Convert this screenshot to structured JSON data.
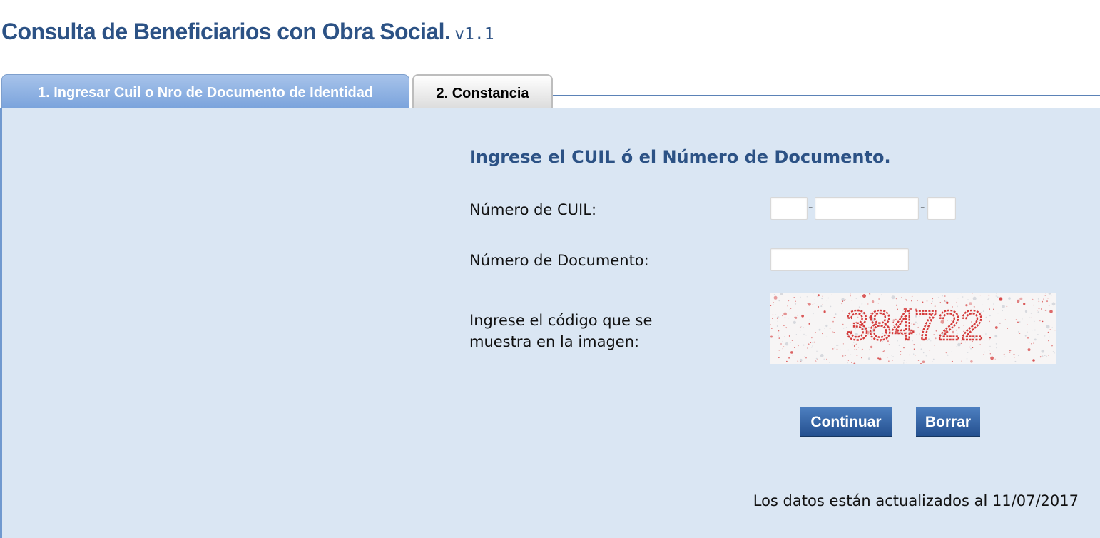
{
  "header": {
    "title": "Consulta de Beneficiarios con Obra Social.",
    "version": "v1.1"
  },
  "tabs": [
    {
      "label": "1. Ingresar Cuil o Nro de Documento de Identidad",
      "state": "inactive"
    },
    {
      "label": "2. Constancia",
      "state": "active"
    }
  ],
  "form": {
    "title": "Ingrese el CUIL ó el Número de Documento.",
    "cuil_label": "Número de CUIL:",
    "cuil_separator": "-",
    "cuil_prefix_value": "",
    "cuil_number_value": "",
    "cuil_check_value": "",
    "documento_label": "Número de Documento:",
    "documento_value": "",
    "captcha_label_line1": "Ingrese el código que se",
    "captcha_label_line2": "muestra en la imagen:",
    "captcha_code": "384722",
    "continuar_label": "Continuar",
    "borrar_label": "Borrar"
  },
  "footer": {
    "updated_note": "Los datos están actualizados al 11/07/2017"
  },
  "colors": {
    "title": "#2c5285",
    "panel_bg": "#dae6f3",
    "button": "#2f5c9a",
    "captcha_text": "#d43a3a"
  }
}
